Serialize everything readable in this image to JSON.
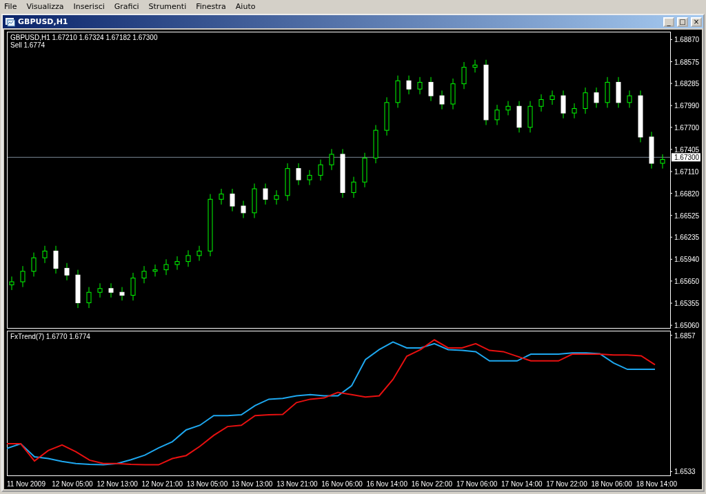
{
  "menu": [
    {
      "label": "File"
    },
    {
      "label": "Visualizza"
    },
    {
      "label": "Inserisci"
    },
    {
      "label": "Grafici"
    },
    {
      "label": "Strumenti"
    },
    {
      "label": "Finestra"
    },
    {
      "label": "Aiuto"
    }
  ],
  "window": {
    "title": "GBPUSD,H1",
    "buttons": [
      "_",
      "□",
      "×"
    ]
  },
  "main_pane": {
    "header": "GBPUSD,H1  1.67210 1.67324 1.67182 1.67300",
    "sell": "Sell 1.6774",
    "chart_data": {
      "type": "candlestick",
      "ylim": [
        1.6502,
        1.6897
      ],
      "yticks": [
        {
          "value": 1.6887,
          "label": "1.68870"
        },
        {
          "value": 1.68575,
          "label": "1.68575"
        },
        {
          "value": 1.68285,
          "label": "1.68285"
        },
        {
          "value": 1.6799,
          "label": "1.67990"
        },
        {
          "value": 1.677,
          "label": "1.67700"
        },
        {
          "value": 1.67405,
          "label": "1.67405"
        },
        {
          "value": 1.6711,
          "label": "1.67110"
        },
        {
          "value": 1.6682,
          "label": "1.66820"
        },
        {
          "value": 1.66525,
          "label": "1.66525"
        },
        {
          "value": 1.66235,
          "label": "1.66235"
        },
        {
          "value": 1.6594,
          "label": "1.65940"
        },
        {
          "value": 1.6565,
          "label": "1.65650"
        },
        {
          "value": 1.65355,
          "label": "1.65355"
        },
        {
          "value": 1.6506,
          "label": "1.65060"
        }
      ],
      "ref_lines": [
        {
          "axis": "y",
          "value": 1.673,
          "label": "1.67300",
          "color": "#7d8a99"
        }
      ],
      "ohlc": [
        [
          1.656,
          1.6571,
          1.6553,
          1.6564
        ],
        [
          1.6564,
          1.6585,
          1.6557,
          1.6578
        ],
        [
          1.6578,
          1.6603,
          1.6571,
          1.6596
        ],
        [
          1.6596,
          1.6612,
          1.6589,
          1.6605
        ],
        [
          1.6605,
          1.6612,
          1.6575,
          1.6582
        ],
        [
          1.6582,
          1.6589,
          1.6566,
          1.6573
        ],
        [
          1.6573,
          1.658,
          1.6529,
          1.6536
        ],
        [
          1.6536,
          1.6557,
          1.6529,
          1.655
        ],
        [
          1.655,
          1.6562,
          1.6543,
          1.6555
        ],
        [
          1.6555,
          1.6562,
          1.6543,
          1.655
        ],
        [
          1.655,
          1.6557,
          1.6539,
          1.6546
        ],
        [
          1.6546,
          1.6576,
          1.6539,
          1.6569
        ],
        [
          1.6569,
          1.6585,
          1.6562,
          1.6578
        ],
        [
          1.6578,
          1.6587,
          1.6571,
          1.658
        ],
        [
          1.658,
          1.6594,
          1.6573,
          1.6587
        ],
        [
          1.6587,
          1.6598,
          1.658,
          1.6591
        ],
        [
          1.6591,
          1.6606,
          1.6584,
          1.6599
        ],
        [
          1.6599,
          1.6612,
          1.6592,
          1.6605
        ],
        [
          1.6605,
          1.6681,
          1.6598,
          1.6674
        ],
        [
          1.6674,
          1.6688,
          1.6667,
          1.6681
        ],
        [
          1.6681,
          1.6688,
          1.6658,
          1.6665
        ],
        [
          1.6665,
          1.6672,
          1.6649,
          1.6656
        ],
        [
          1.6656,
          1.6695,
          1.6649,
          1.6688
        ],
        [
          1.6688,
          1.6695,
          1.6667,
          1.6674
        ],
        [
          1.6674,
          1.6686,
          1.6667,
          1.6679
        ],
        [
          1.6679,
          1.6722,
          1.6672,
          1.6715
        ],
        [
          1.6715,
          1.6722,
          1.6693,
          1.67
        ],
        [
          1.67,
          1.6713,
          1.6693,
          1.6706
        ],
        [
          1.6706,
          1.6727,
          1.6699,
          1.672
        ],
        [
          1.672,
          1.6741,
          1.6713,
          1.6734
        ],
        [
          1.6734,
          1.6741,
          1.6676,
          1.6683
        ],
        [
          1.6683,
          1.6704,
          1.6676,
          1.6697
        ],
        [
          1.6697,
          1.6736,
          1.669,
          1.6729
        ],
        [
          1.6729,
          1.6773,
          1.6722,
          1.6766
        ],
        [
          1.6766,
          1.681,
          1.6759,
          1.6803
        ],
        [
          1.6803,
          1.6839,
          1.6796,
          1.6832
        ],
        [
          1.6832,
          1.6839,
          1.6814,
          1.6821
        ],
        [
          1.6821,
          1.6837,
          1.6814,
          1.683
        ],
        [
          1.683,
          1.6837,
          1.6805,
          1.6812
        ],
        [
          1.6812,
          1.6819,
          1.6794,
          1.6801
        ],
        [
          1.6801,
          1.6835,
          1.6794,
          1.6828
        ],
        [
          1.6828,
          1.6857,
          1.6821,
          1.685
        ],
        [
          1.685,
          1.686,
          1.6843,
          1.6853
        ],
        [
          1.6853,
          1.686,
          1.6773,
          1.678
        ],
        [
          1.678,
          1.68,
          1.6773,
          1.6793
        ],
        [
          1.6793,
          1.6805,
          1.6786,
          1.6798
        ],
        [
          1.6798,
          1.6805,
          1.6763,
          1.677
        ],
        [
          1.677,
          1.6805,
          1.6763,
          1.6798
        ],
        [
          1.6798,
          1.6814,
          1.6791,
          1.6807
        ],
        [
          1.6807,
          1.6819,
          1.68,
          1.6812
        ],
        [
          1.6812,
          1.6819,
          1.6782,
          1.6789
        ],
        [
          1.6789,
          1.6802,
          1.6782,
          1.6795
        ],
        [
          1.6795,
          1.6823,
          1.6788,
          1.6816
        ],
        [
          1.6816,
          1.6823,
          1.6796,
          1.6803
        ],
        [
          1.6803,
          1.6837,
          1.6796,
          1.683
        ],
        [
          1.683,
          1.6837,
          1.6796,
          1.6803
        ],
        [
          1.6803,
          1.6819,
          1.6796,
          1.6812
        ],
        [
          1.6812,
          1.6819,
          1.675,
          1.6757
        ],
        [
          1.6757,
          1.6764,
          1.6715,
          1.6722
        ],
        [
          1.6722,
          1.6734,
          1.6715,
          1.6727
        ]
      ]
    }
  },
  "indicator_pane": {
    "header": "FxTrend(7) 1.6770 1.6774",
    "chart_data": {
      "type": "line",
      "ylim": [
        1.6523,
        1.6867
      ],
      "yticks": [
        {
          "value": 1.6857,
          "label": "1.6857"
        },
        {
          "value": 1.6533,
          "label": "1.6533"
        }
      ],
      "series": [
        {
          "color": "#1ea8f0",
          "values": [
            1.6588,
            1.6599,
            1.6568,
            1.6564,
            1.6557,
            1.6552,
            1.655,
            1.6549,
            1.6552,
            1.6561,
            1.6572,
            1.6589,
            1.6604,
            1.6632,
            1.6643,
            1.6666,
            1.6666,
            1.6668,
            1.669,
            1.6705,
            1.6707,
            1.6713,
            1.6716,
            1.6713,
            1.6713,
            1.6737,
            1.6799,
            1.6823,
            1.6841,
            1.6827,
            1.6827,
            1.6837,
            1.6823,
            1.6821,
            1.6818,
            1.6796,
            1.6796,
            1.6796,
            1.6812,
            1.6812,
            1.6812,
            1.6815,
            1.6815,
            1.6813,
            1.6791,
            1.6776,
            1.6776,
            1.6776
          ]
        },
        {
          "color": "#e81010",
          "values": [
            1.6599,
            1.6599,
            1.6558,
            1.6583,
            1.6596,
            1.658,
            1.656,
            1.6552,
            1.6552,
            1.655,
            1.6549,
            1.6549,
            1.6564,
            1.6571,
            1.6593,
            1.6619,
            1.664,
            1.6643,
            1.6666,
            1.6668,
            1.6669,
            1.6697,
            1.6705,
            1.6708,
            1.6721,
            1.6716,
            1.671,
            1.6713,
            1.6752,
            1.6807,
            1.6823,
            1.6846,
            1.6827,
            1.6827,
            1.6837,
            1.6821,
            1.6818,
            1.6807,
            1.6796,
            1.6796,
            1.6796,
            1.6812,
            1.6812,
            1.6812,
            1.681,
            1.681,
            1.6808,
            1.6787
          ]
        }
      ]
    }
  },
  "time_axis": [
    "11 Nov 2009",
    "12 Nov 05:00",
    "12 Nov 13:00",
    "12 Nov 21:00",
    "13 Nov 05:00",
    "13 Nov 13:00",
    "13 Nov 21:00",
    "16 Nov 06:00",
    "16 Nov 14:00",
    "16 Nov 22:00",
    "17 Nov 06:00",
    "17 Nov 14:00",
    "17 Nov 22:00",
    "18 Nov 06:00",
    "18 Nov 14:00"
  ]
}
